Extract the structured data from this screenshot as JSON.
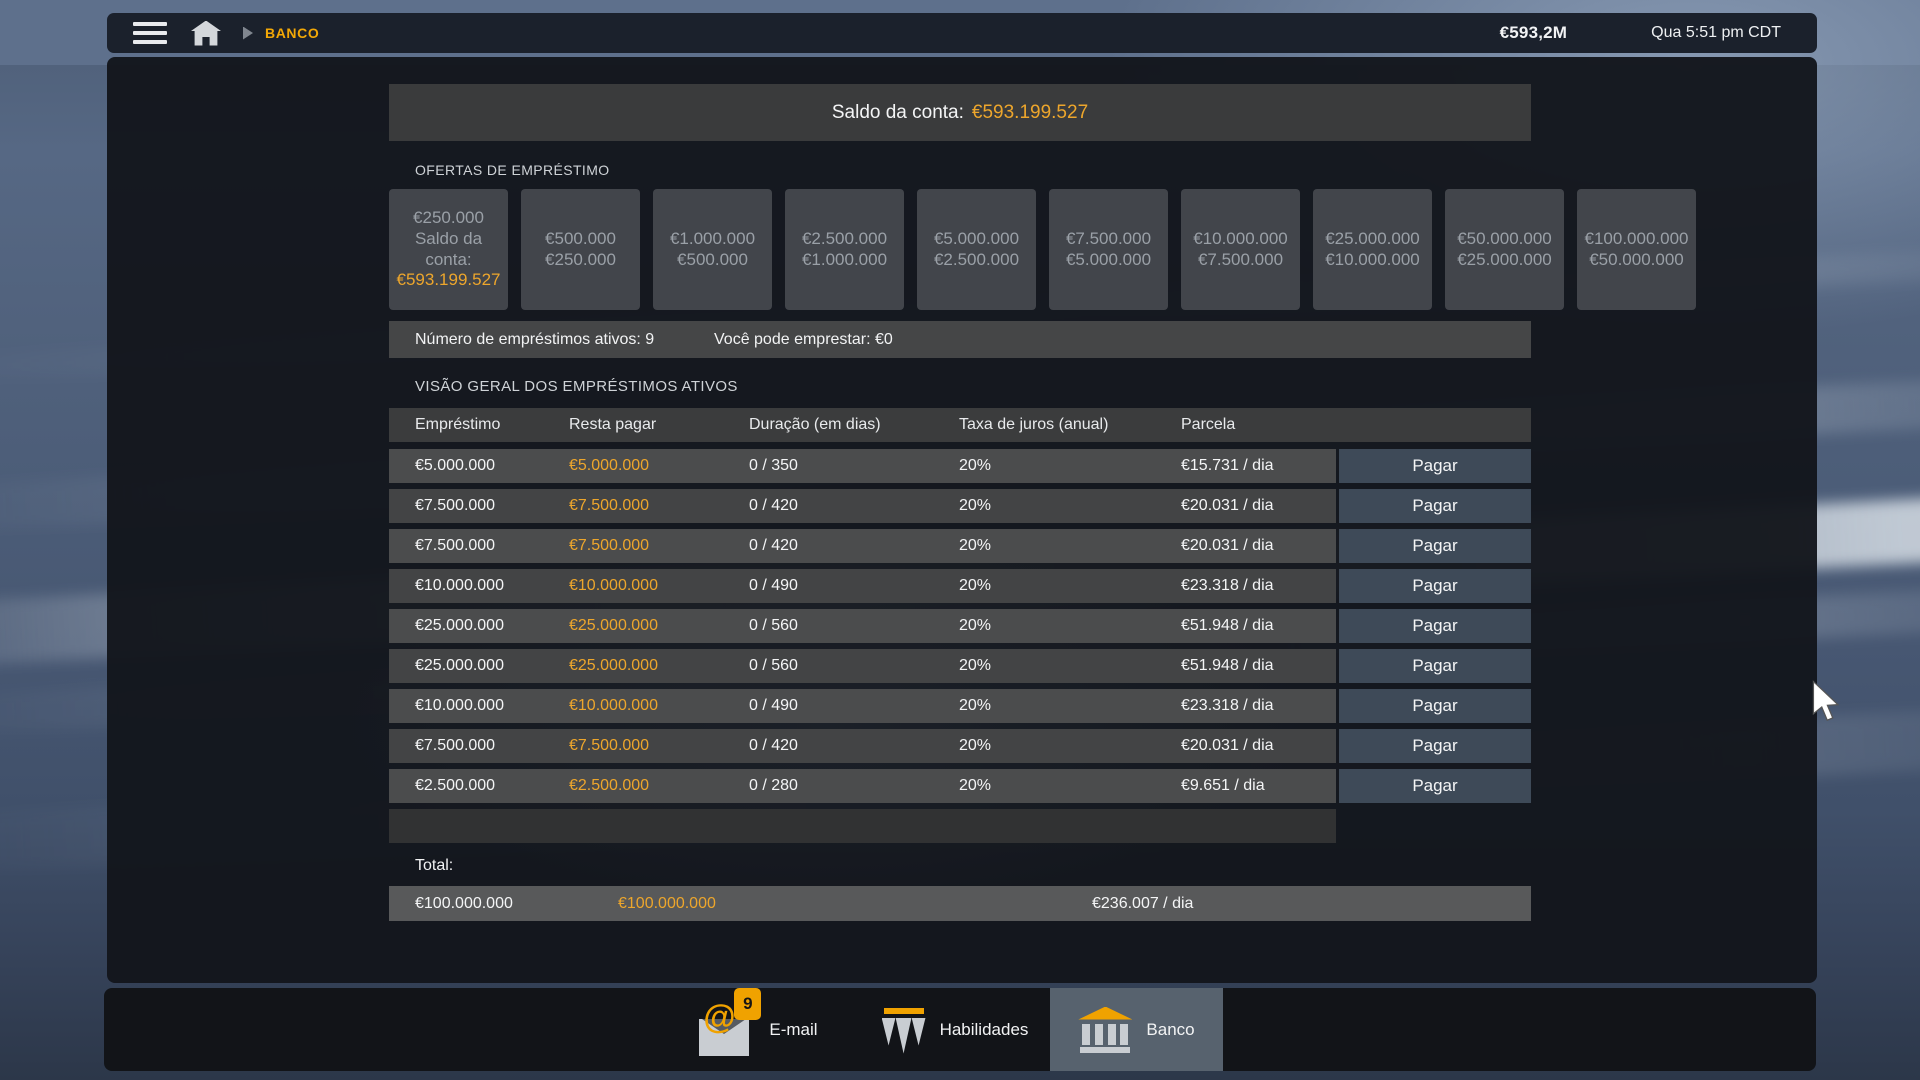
{
  "top_bar": {
    "breadcrumb": "BANCO",
    "money": "€593,2M",
    "time": "Qua 5:51 pm CDT"
  },
  "balance_bar": {
    "label": "Saldo da conta:",
    "value": "€593.199.527"
  },
  "offers": {
    "title": "OFERTAS DE EMPRÉSTIMO",
    "tiles": [
      {
        "lines": [
          {
            "t": "€250.000"
          },
          {
            "t": "Saldo da conta:"
          },
          {
            "t": "€593.199.527",
            "accent": true,
            "nowrap": true
          }
        ]
      },
      {
        "lines": [
          {
            "t": "€500.000"
          },
          {
            "t": "€250.000"
          }
        ]
      },
      {
        "lines": [
          {
            "t": "€1.000.000"
          },
          {
            "t": "€500.000"
          }
        ]
      },
      {
        "lines": [
          {
            "t": "€2.500.000"
          },
          {
            "t": "€1.000.000"
          }
        ]
      },
      {
        "lines": [
          {
            "t": "€5.000.000"
          },
          {
            "t": "€2.500.000"
          }
        ]
      },
      {
        "lines": [
          {
            "t": "€7.500.000"
          },
          {
            "t": "€5.000.000"
          }
        ]
      },
      {
        "lines": [
          {
            "t": "€10.000.000"
          },
          {
            "t": "€7.500.000"
          }
        ]
      },
      {
        "lines": [
          {
            "t": "€25.000.000"
          },
          {
            "t": "€10.000.000"
          }
        ]
      },
      {
        "lines": [
          {
            "t": "€50.000.000"
          },
          {
            "t": "€25.000.000"
          }
        ]
      },
      {
        "lines": [
          {
            "t": "€100.000.000"
          },
          {
            "t": "€50.000.000"
          }
        ]
      }
    ]
  },
  "summary_bar": {
    "active_loans": "Número de empréstimos ativos: 9",
    "can_borrow": "Você pode emprestar: €0"
  },
  "loans_table": {
    "title": "VISÃO GERAL DOS EMPRÉSTIMOS ATIVOS",
    "headers": [
      "Empréstimo",
      "Resta pagar",
      "Duração (em dias)",
      "Taxa de juros (anual)",
      "Parcela"
    ],
    "pay_label": "Pagar",
    "rows": [
      {
        "loan": "€5.000.000",
        "remaining": "€5.000.000",
        "duration": "0 / 350",
        "interest": "20%",
        "installment": "€15.731 / dia"
      },
      {
        "loan": "€7.500.000",
        "remaining": "€7.500.000",
        "duration": "0 / 420",
        "interest": "20%",
        "installment": "€20.031 / dia"
      },
      {
        "loan": "€7.500.000",
        "remaining": "€7.500.000",
        "duration": "0 / 420",
        "interest": "20%",
        "installment": "€20.031 / dia"
      },
      {
        "loan": "€10.000.000",
        "remaining": "€10.000.000",
        "duration": "0 / 490",
        "interest": "20%",
        "installment": "€23.318 / dia"
      },
      {
        "loan": "€25.000.000",
        "remaining": "€25.000.000",
        "duration": "0 / 560",
        "interest": "20%",
        "installment": "€51.948 / dia"
      },
      {
        "loan": "€25.000.000",
        "remaining": "€25.000.000",
        "duration": "0 / 560",
        "interest": "20%",
        "installment": "€51.948 / dia"
      },
      {
        "loan": "€10.000.000",
        "remaining": "€10.000.000",
        "duration": "0 / 490",
        "interest": "20%",
        "installment": "€23.318 / dia"
      },
      {
        "loan": "€7.500.000",
        "remaining": "€7.500.000",
        "duration": "0 / 420",
        "interest": "20%",
        "installment": "€20.031 / dia"
      },
      {
        "loan": "€2.500.000",
        "remaining": "€2.500.000",
        "duration": "0 / 280",
        "interest": "20%",
        "installment": "€9.651 / dia"
      }
    ],
    "total_label": "Total:",
    "total": {
      "loan": "€100.000.000",
      "remaining": "€100.000.000",
      "installment": "€236.007 / dia"
    }
  },
  "dock": {
    "email": {
      "label": "E-mail",
      "badge": "9"
    },
    "skills": {
      "label": "Habilidades"
    },
    "bank": {
      "label": "Banco",
      "selected": true
    }
  },
  "colors": {
    "accent_orange": "#eda62c",
    "breadcrumb_orange": "#f3a806",
    "pay_button": "#3e4a58",
    "dock_selected": "#57626e",
    "panel_dark": "#13161c"
  }
}
